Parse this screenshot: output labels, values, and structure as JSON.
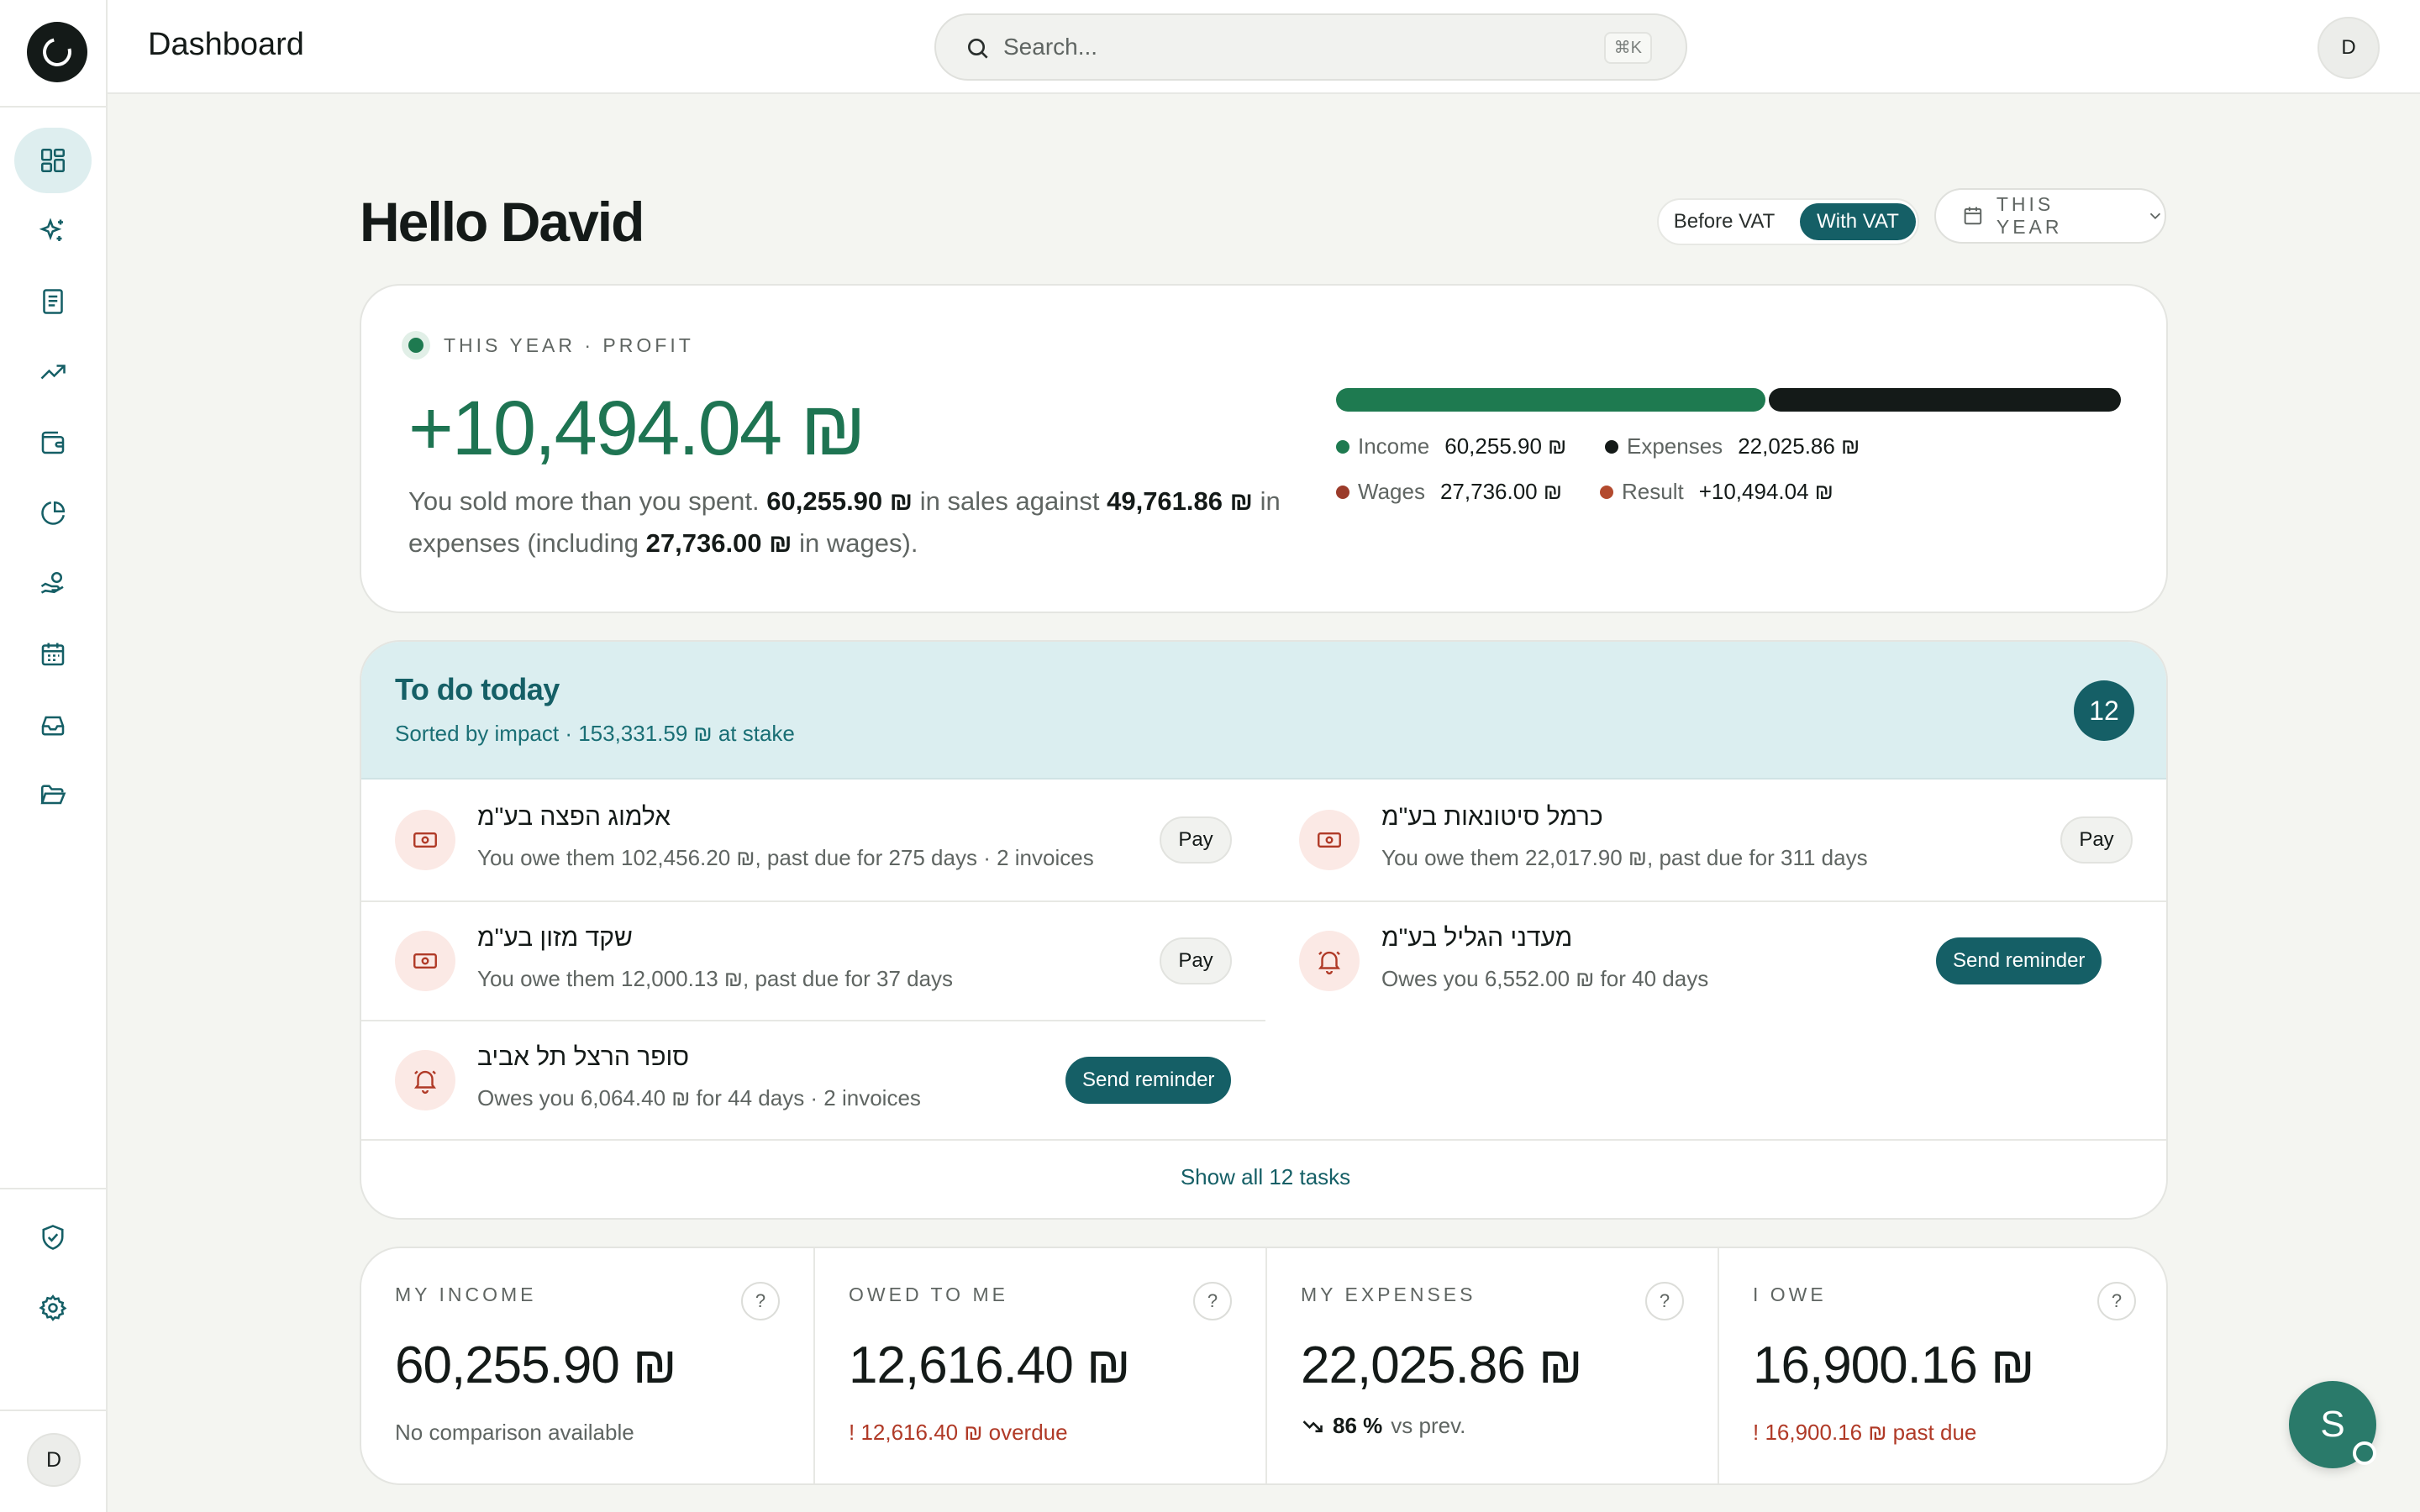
{
  "header": {
    "title": "Dashboard",
    "search_placeholder": "Search...",
    "search_shortcut": "⌘K",
    "avatar_initial": "D"
  },
  "sidebar": {
    "items": [
      {
        "icon": "grid-icon",
        "active": true
      },
      {
        "icon": "sparkles-icon",
        "active": false
      },
      {
        "icon": "document-icon",
        "active": false
      },
      {
        "icon": "trending-up-icon",
        "active": false
      },
      {
        "icon": "wallet-icon",
        "active": false
      },
      {
        "icon": "pie-chart-icon",
        "active": false
      },
      {
        "icon": "hand-coins-icon",
        "active": false
      },
      {
        "icon": "calendar-icon",
        "active": false
      },
      {
        "icon": "inbox-icon",
        "active": false
      },
      {
        "icon": "folder-icon",
        "active": false
      }
    ],
    "bottom_items": [
      {
        "icon": "shield-check-icon"
      },
      {
        "icon": "gear-icon"
      }
    ],
    "avatar_initial": "D"
  },
  "greeting": "Hello David",
  "vat_toggle": {
    "before": "Before VAT",
    "with": "With VAT",
    "selected": "With VAT"
  },
  "period": {
    "label": "THIS YEAR"
  },
  "profit": {
    "eyebrow": "THIS YEAR · PROFIT",
    "amount": "+10,494.04 ₪",
    "sentence": {
      "p1": "You sold more than you spent. ",
      "sales": "60,255.90 ₪",
      "p2": " in sales against ",
      "expenses": "49,761.86 ₪",
      "p3": " in expenses (including ",
      "wages": "27,736.00 ₪",
      "p4": " in wages)."
    },
    "bar": {
      "income_share": 0.5475,
      "expense_share": 0.4525
    },
    "legend": {
      "income_label": "Income",
      "income_value": "60,255.90 ₪",
      "expenses_label": "Expenses",
      "expenses_value": "22,025.86 ₪",
      "wages_label": "Wages",
      "wages_value": "27,736.00 ₪",
      "result_label": "Result",
      "result_value": "+10,494.04 ₪"
    },
    "colors": {
      "income": "#1e7a50",
      "expenses": "#141a18",
      "wages": "#9b3b2a",
      "result": "#b34a2e"
    }
  },
  "todo": {
    "title": "To do today",
    "subtitle": "Sorted by impact · 153,331.59 ₪ at stake",
    "count": "12",
    "tasks": [
      {
        "name": "אלמוג הפצה בע\"מ",
        "desc": "You owe them 102,456.20 ₪, past due for 275 days · 2 invoices",
        "action": "Pay",
        "icon": "banknote-icon"
      },
      {
        "name": "כרמל סיטונאות בע\"מ",
        "desc": "You owe them 22,017.90 ₪, past due for 311 days",
        "action": "Pay",
        "icon": "banknote-icon"
      },
      {
        "name": "שקד מזון בע\"מ",
        "desc": "You owe them 12,000.13 ₪, past due for 37 days",
        "action": "Pay",
        "icon": "banknote-icon"
      },
      {
        "name": "מעדני הגליל בע\"מ",
        "desc": "Owes you 6,552.00 ₪ for 40 days",
        "action": "Send reminder",
        "icon": "bell-icon"
      },
      {
        "name": "סופר הרצל תל אביב",
        "desc": "Owes you 6,064.40 ₪ for 44 days · 2 invoices",
        "action": "Send reminder",
        "icon": "bell-icon"
      }
    ],
    "show_all": "Show all 12 tasks"
  },
  "stats": [
    {
      "label": "MY INCOME",
      "value": "60,255.90 ₪",
      "note": "No comparison available"
    },
    {
      "label": "OWED TO ME",
      "value": "12,616.40 ₪",
      "note": "! 12,616.40 ₪ overdue"
    },
    {
      "label": "MY EXPENSES",
      "value": "22,025.86 ₪",
      "trend_value": "86 %",
      "trend_text": "vs prev."
    },
    {
      "label": "I OWE",
      "value": "16,900.16 ₪",
      "note": "! 16,900.16 ₪ past due"
    }
  ],
  "help_label": "?",
  "chat_avatar": "S"
}
